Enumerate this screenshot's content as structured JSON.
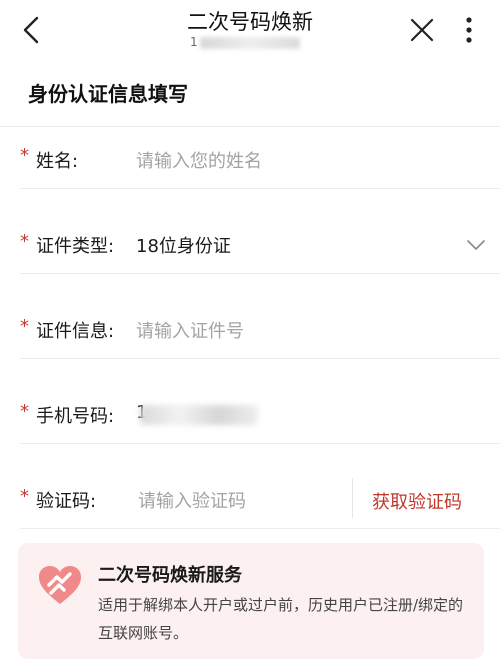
{
  "nav": {
    "title": "二次号码焕新",
    "subtitle": "1",
    "icons": {
      "back": "chevron-left-icon",
      "close": "close-icon",
      "more": "more-vertical-icon"
    }
  },
  "form": {
    "title": "身份认证信息填写",
    "required_mark": "*",
    "fields": [
      {
        "label": "姓名:",
        "placeholder": "请输入您的姓名"
      },
      {
        "label": "证件类型:",
        "value": "18位身份证"
      },
      {
        "label": "证件信息:",
        "placeholder": "请输入证件号"
      },
      {
        "label": "手机号码:",
        "value": "1"
      },
      {
        "label": "验证码:",
        "placeholder": "请输入验证码",
        "action": "获取验证码"
      }
    ]
  },
  "info_card": {
    "title": "二次号码焕新服务",
    "description": "适用于解绑本人开户或过户前，历史用户已注册/绑定的互联网账号。"
  },
  "colors": {
    "accent": "#c23a31",
    "placeholder": "#a3a3a3",
    "card_bg": "#fcf1f0",
    "logo": "#f08a8a"
  }
}
